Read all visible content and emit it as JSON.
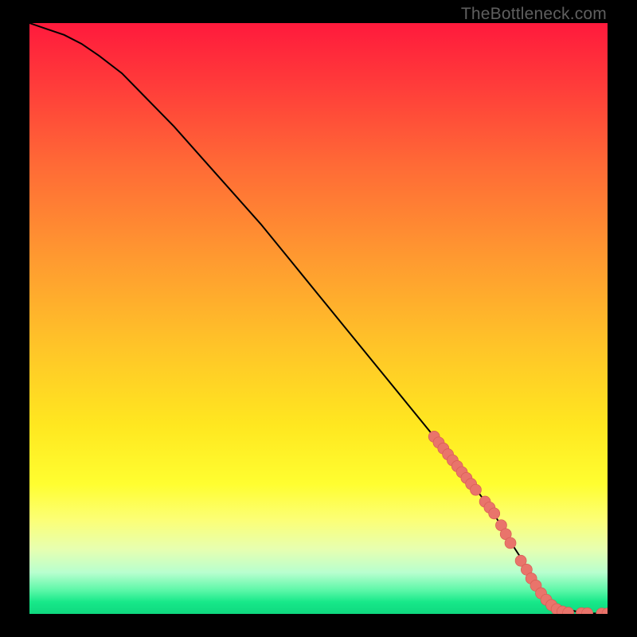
{
  "watermark": "TheBottleneck.com",
  "colors": {
    "curve": "#000000",
    "marker_fill": "#e9746b",
    "marker_stroke": "#d85c54",
    "plot_border": "#000000"
  },
  "chart_data": {
    "type": "line",
    "title": "",
    "xlabel": "",
    "ylabel": "",
    "xlim": [
      0,
      100
    ],
    "ylim": [
      0,
      100
    ],
    "grid": false,
    "legend": false,
    "series": [
      {
        "name": "curve",
        "x": [
          0,
          3,
          6,
          9,
          12,
          16,
          20,
          25,
          30,
          35,
          40,
          45,
          50,
          55,
          60,
          65,
          70,
          75,
          80,
          84,
          87,
          89,
          91,
          93,
          95,
          97,
          100
        ],
        "y": [
          100,
          99,
          98,
          96.5,
          94.5,
          91.5,
          87.5,
          82.5,
          77,
          71.5,
          66,
          60,
          54,
          48,
          42,
          36,
          30,
          24,
          17.5,
          11,
          6.5,
          3.5,
          1.7,
          0.8,
          0.3,
          0.1,
          0.05
        ]
      }
    ],
    "markers": [
      {
        "x": 70.0,
        "y": 30.0
      },
      {
        "x": 70.8,
        "y": 29.0
      },
      {
        "x": 71.6,
        "y": 28.0
      },
      {
        "x": 72.4,
        "y": 27.0
      },
      {
        "x": 73.2,
        "y": 26.0
      },
      {
        "x": 74.0,
        "y": 25.0
      },
      {
        "x": 74.8,
        "y": 24.0
      },
      {
        "x": 75.6,
        "y": 23.0
      },
      {
        "x": 76.4,
        "y": 22.0
      },
      {
        "x": 77.2,
        "y": 21.0
      },
      {
        "x": 78.8,
        "y": 19.0
      },
      {
        "x": 79.6,
        "y": 18.0
      },
      {
        "x": 80.4,
        "y": 17.0
      },
      {
        "x": 81.6,
        "y": 15.0
      },
      {
        "x": 82.4,
        "y": 13.5
      },
      {
        "x": 83.2,
        "y": 12.0
      },
      {
        "x": 85.0,
        "y": 9.0
      },
      {
        "x": 86.0,
        "y": 7.5
      },
      {
        "x": 86.8,
        "y": 6.0
      },
      {
        "x": 87.6,
        "y": 4.8
      },
      {
        "x": 88.5,
        "y": 3.5
      },
      {
        "x": 89.4,
        "y": 2.4
      },
      {
        "x": 90.3,
        "y": 1.5
      },
      {
        "x": 91.2,
        "y": 0.8
      },
      {
        "x": 92.2,
        "y": 0.4
      },
      {
        "x": 93.2,
        "y": 0.2
      },
      {
        "x": 95.5,
        "y": 0.12
      },
      {
        "x": 96.5,
        "y": 0.1
      },
      {
        "x": 99.0,
        "y": 0.06
      },
      {
        "x": 100.0,
        "y": 0.05
      }
    ]
  }
}
